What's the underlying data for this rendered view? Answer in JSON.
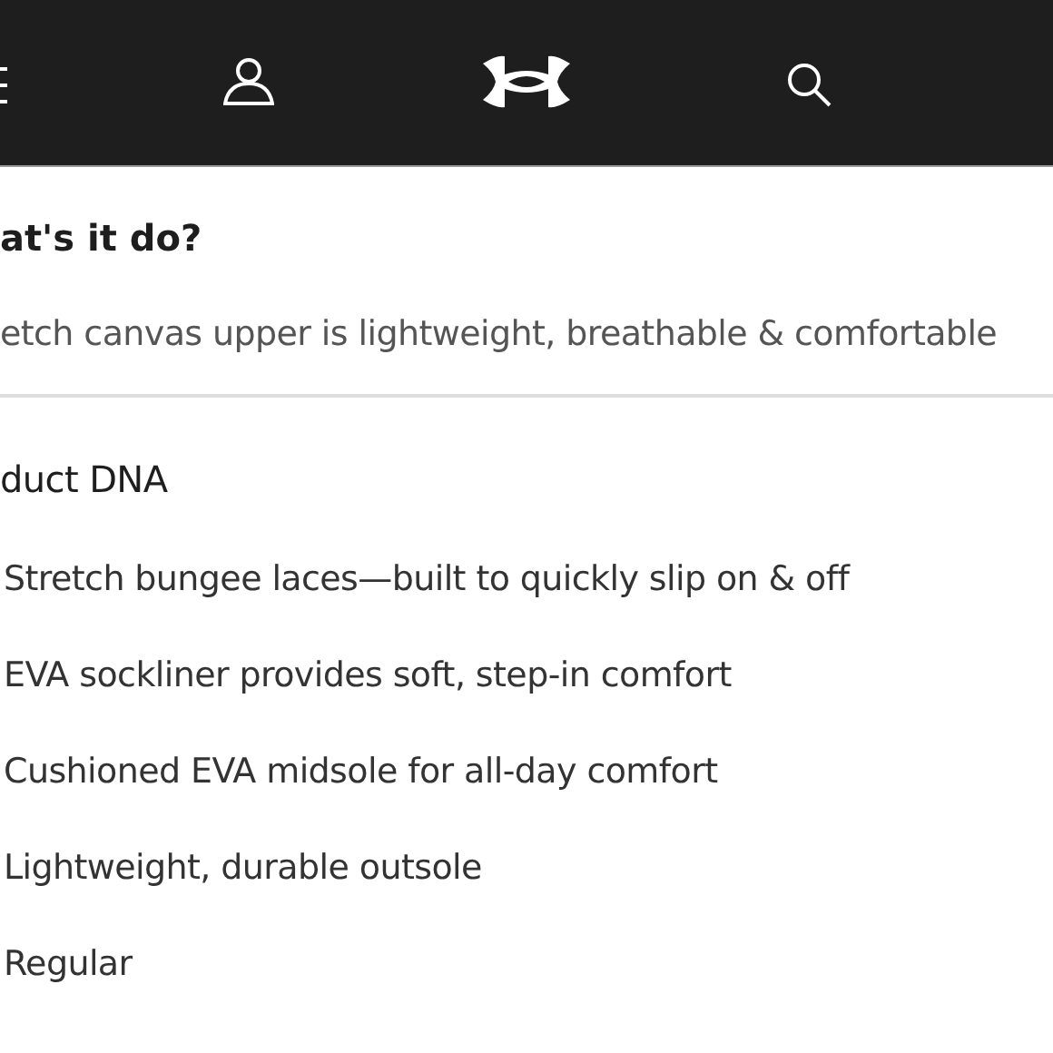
{
  "section_1": {
    "title": "at's it do?",
    "text": "etch canvas upper is lightweight, breathable & comfortable"
  },
  "section_2": {
    "title": "duct DNA",
    "items": [
      "Stretch bungee laces—built to quickly slip on & off",
      "EVA sockliner provides soft, step-in comfort",
      "Cushioned EVA midsole for all-day comfort",
      "Lightweight, durable outsole",
      "Regular"
    ]
  }
}
